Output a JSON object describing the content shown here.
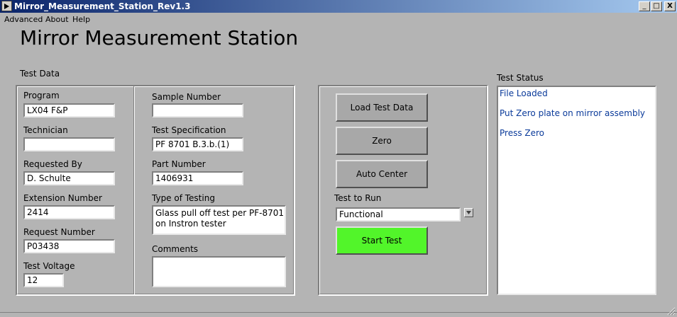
{
  "window": {
    "title": "Mirror_Measurement_Station_Rev1.3",
    "min": "_",
    "max": "□",
    "close": "X"
  },
  "menu": [
    "Advanced",
    "About",
    "Help"
  ],
  "heading": "Mirror Measurement Station",
  "test_data": {
    "label": "Test Data",
    "program": {
      "label": "Program",
      "value": "LX04 F&P"
    },
    "technician": {
      "label": "Technician",
      "value": ""
    },
    "requested_by": {
      "label": "Requested By",
      "value": "D. Schulte"
    },
    "extension_number": {
      "label": "Extension Number",
      "value": "2414"
    },
    "request_number": {
      "label": "Request Number",
      "value": "P03438"
    },
    "test_voltage": {
      "label": "Test Voltage",
      "value": "12"
    },
    "sample_number": {
      "label": "Sample Number",
      "value": ""
    },
    "test_specification": {
      "label": "Test Specification",
      "value": "PF 8701 B.3.b.(1)"
    },
    "part_number": {
      "label": "Part Number",
      "value": "1406931"
    },
    "type_of_testing": {
      "label": "Type of Testing",
      "value": "Glass pull off test per PF-8701\non Instron tester"
    },
    "comments": {
      "label": "Comments",
      "value": ""
    }
  },
  "controls": {
    "load_test_data": "Load Test Data",
    "zero": "Zero",
    "auto_center": "Auto Center",
    "test_to_run_label": "Test to Run",
    "test_to_run_value": "Functional",
    "start_test": "Start Test"
  },
  "status": {
    "label": "Test Status",
    "lines": [
      "File Loaded",
      "Put Zero plate on mirror assembly",
      "Press Zero"
    ]
  },
  "colors": {
    "start_button": "#52f52a",
    "status_text": "#0a3a9a",
    "title_bar": "#0a246a"
  }
}
